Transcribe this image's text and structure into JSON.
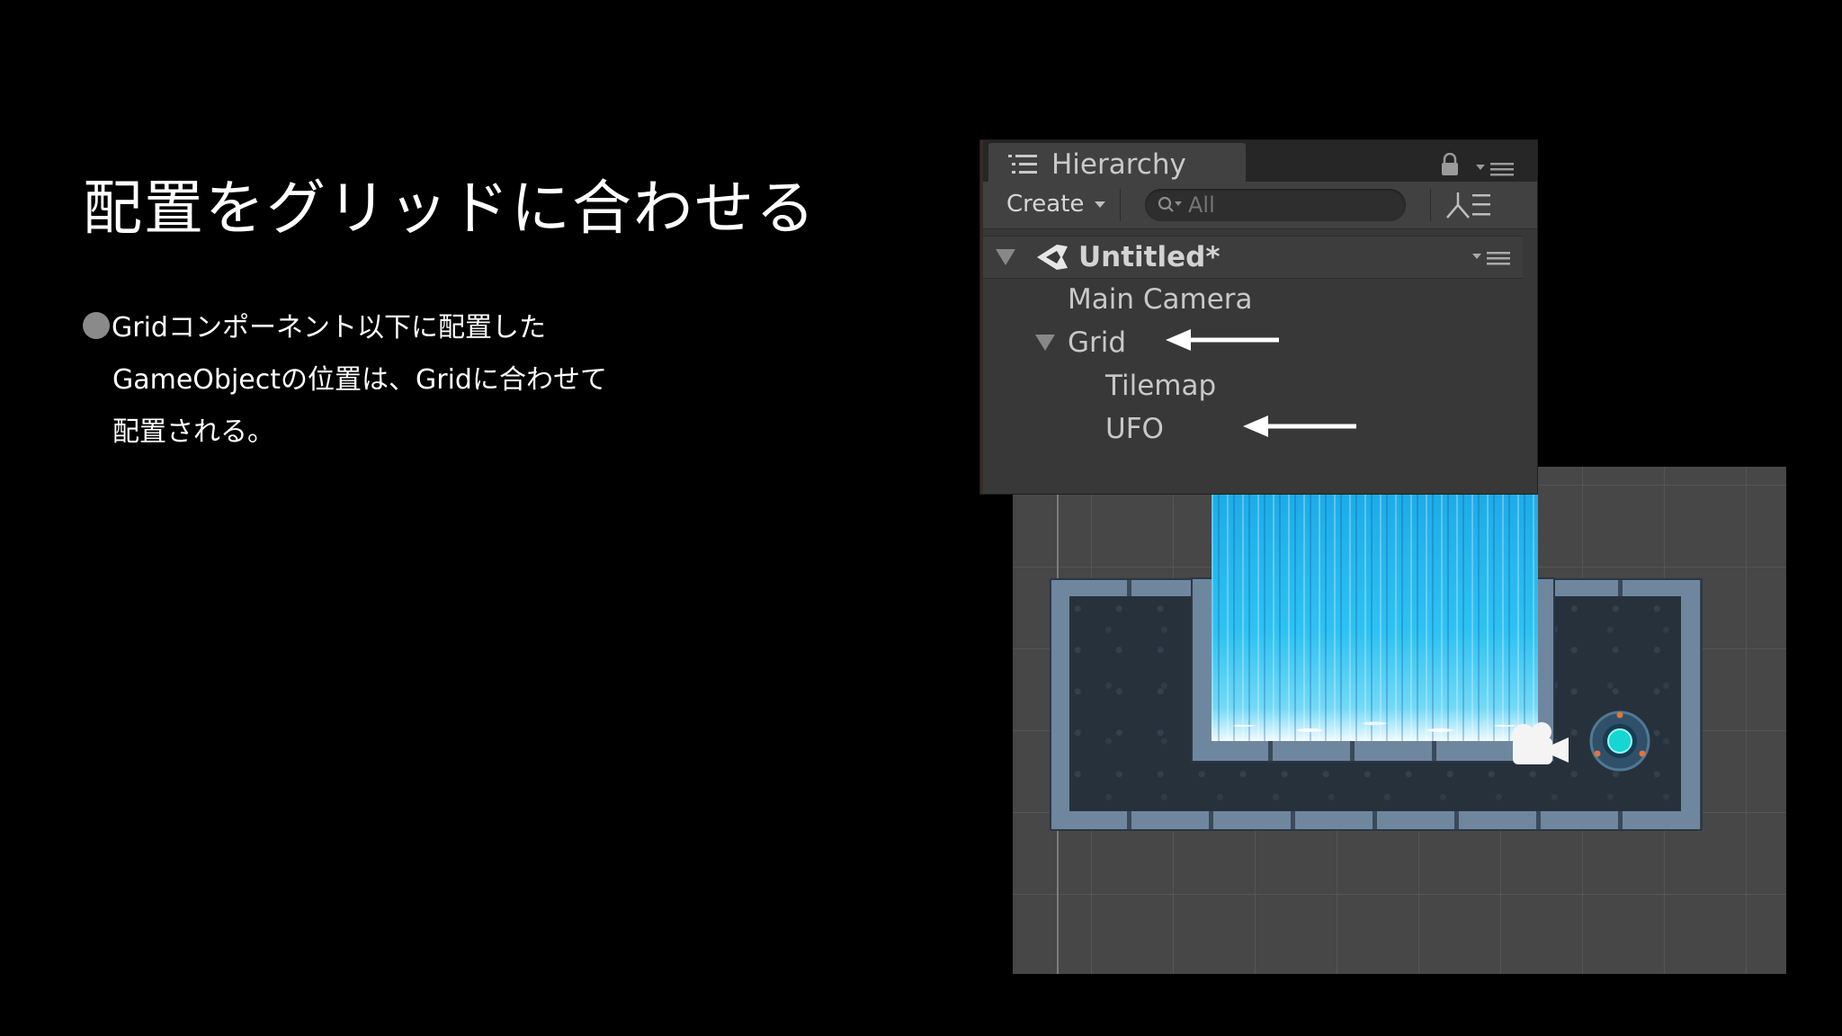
{
  "slide": {
    "title": "配置をグリッドに合わせる",
    "bullet_lines": [
      "Gridコンポーネント以下に配置した",
      "GameObjectの位置は、Gridに合わせて",
      "配置される。"
    ]
  },
  "hierarchy": {
    "tab_label": "Hierarchy",
    "create_label": "Create",
    "search_placeholder": "All",
    "scene_name": "Untitled*",
    "items": [
      {
        "label": "Main Camera",
        "depth": 1
      },
      {
        "label": "Grid",
        "depth": 1,
        "expanded": true
      },
      {
        "label": "Tilemap",
        "depth": 2
      },
      {
        "label": "UFO",
        "depth": 2
      }
    ],
    "arrow_targets": [
      "Grid",
      "UFO"
    ]
  },
  "scene_view": {
    "icons": [
      "camera-gizmo-icon",
      "ufo-sprite"
    ],
    "colors": {
      "grid_bg": "#474747",
      "water": "#2ec2f2",
      "wall": "#6f879e",
      "floor": "#27313b"
    }
  }
}
